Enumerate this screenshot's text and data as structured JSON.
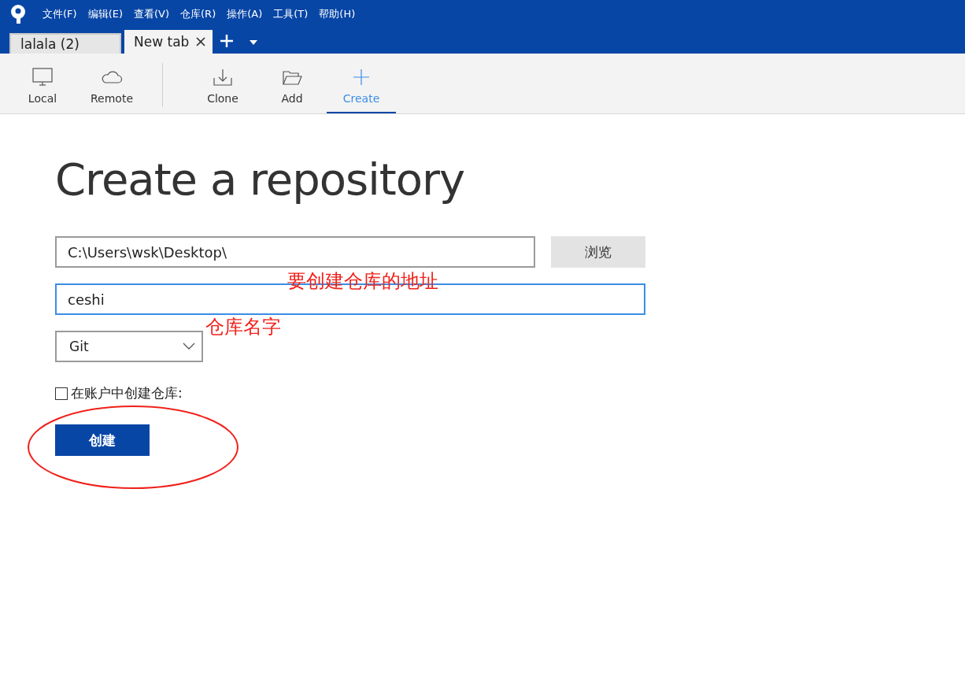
{
  "menu": [
    "文件(F)",
    "编辑(E)",
    "查看(V)",
    "仓库(R)",
    "操作(A)",
    "工具(T)",
    "帮助(H)"
  ],
  "tabs": [
    {
      "label": "lalala (2)",
      "selected": false,
      "closable": false
    },
    {
      "label": "New tab",
      "selected": true,
      "closable": true
    }
  ],
  "toolbar_groups": [
    {
      "items": [
        {
          "kind": "local",
          "label": "Local",
          "selected": false
        },
        {
          "kind": "remote",
          "label": "Remote",
          "selected": false
        }
      ]
    },
    {
      "items": [
        {
          "kind": "clone",
          "label": "Clone",
          "selected": false
        },
        {
          "kind": "add",
          "label": "Add",
          "selected": false
        },
        {
          "kind": "create",
          "label": "Create",
          "selected": true
        }
      ]
    }
  ],
  "form": {
    "title": "Create a repository",
    "path": "C:\\Users\\wsk\\Desktop\\",
    "browse_button": "浏览",
    "name": "ceshi",
    "name_focused": true,
    "vcs": "Git",
    "account_checkbox": {
      "label": "在账户中创建仓库:",
      "checked": false
    },
    "create_button": "创建"
  },
  "annotations": [
    {
      "text": "要创建仓库的地址"
    },
    {
      "text": "仓库名字"
    }
  ]
}
